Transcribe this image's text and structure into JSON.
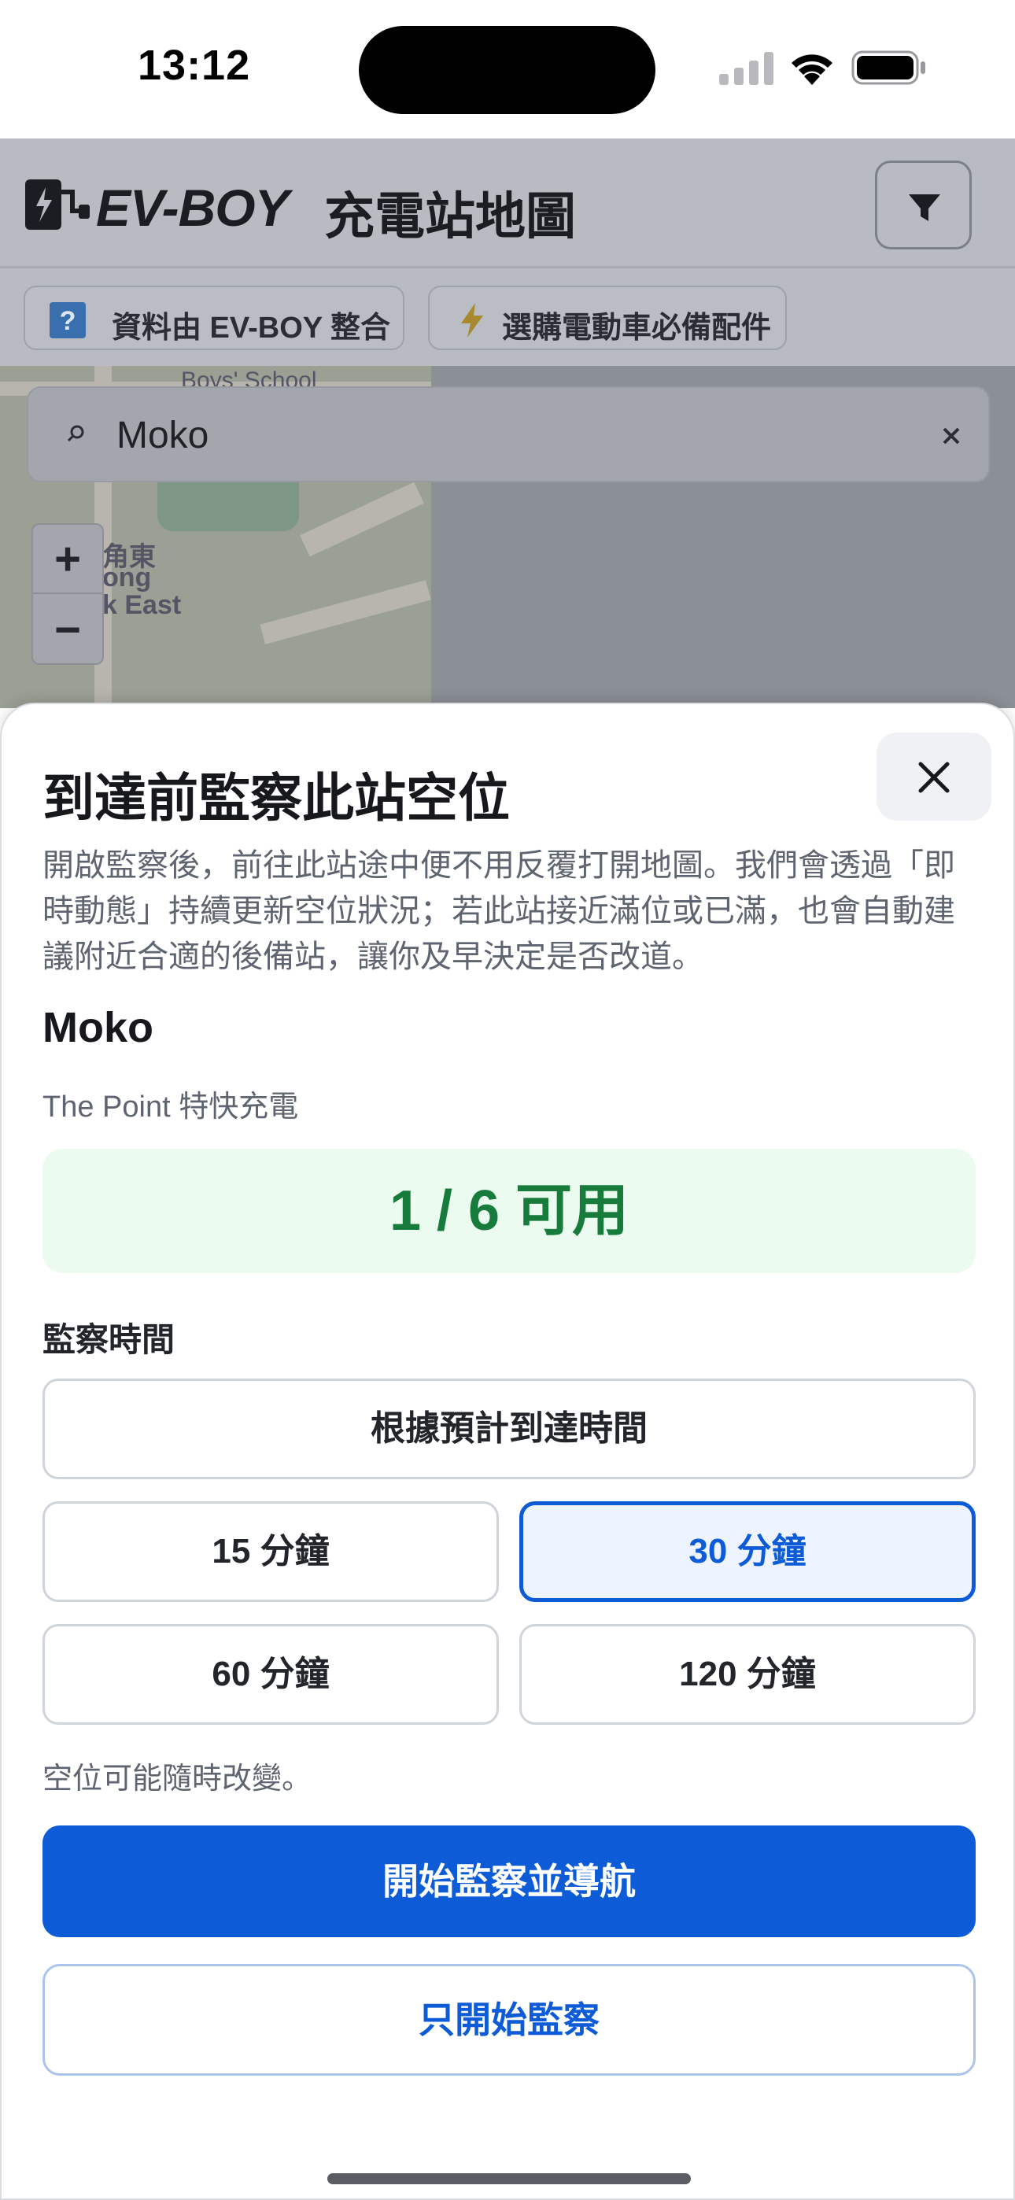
{
  "status_bar": {
    "time": "13:12"
  },
  "header": {
    "logo_text": "EV-BOY",
    "title": "充電站地圖"
  },
  "chips": {
    "data_source": "資料由 EV-BOY 整合",
    "accessories": "選購電動車必備配件"
  },
  "search": {
    "value": "Moko"
  },
  "map": {
    "labels": [
      "Boys' School",
      "角東",
      "ong",
      "k East"
    ]
  },
  "zoom": {
    "in": "+",
    "out": "−"
  },
  "sheet": {
    "title": "到達前監察此站空位",
    "description": "開啟監察後，前往此站途中便不用反覆打開地圖。我們會透過「即時動態」持續更新空位狀況；若此站接近滿位或已滿，也會自動建議附近合適的後備站，讓你及早決定是否改道。",
    "station_name": "Moko",
    "station_sub": "The Point 特快充電",
    "availability": "1 / 6 可用",
    "section_label": "監察時間",
    "options": {
      "eta": "根據預計到達時間",
      "m15": "15 分鐘",
      "m30": "30 分鐘",
      "m60": "60 分鐘",
      "m120": "120 分鐘"
    },
    "selected_option": "30 分鐘",
    "note": "空位可能隨時改變。",
    "primary_button": "開始監察並導航",
    "secondary_button": "只開始監察"
  },
  "colors": {
    "accent": "#0d5bd7",
    "available_text": "#177b3c",
    "available_bg": "#ecfbf0"
  }
}
